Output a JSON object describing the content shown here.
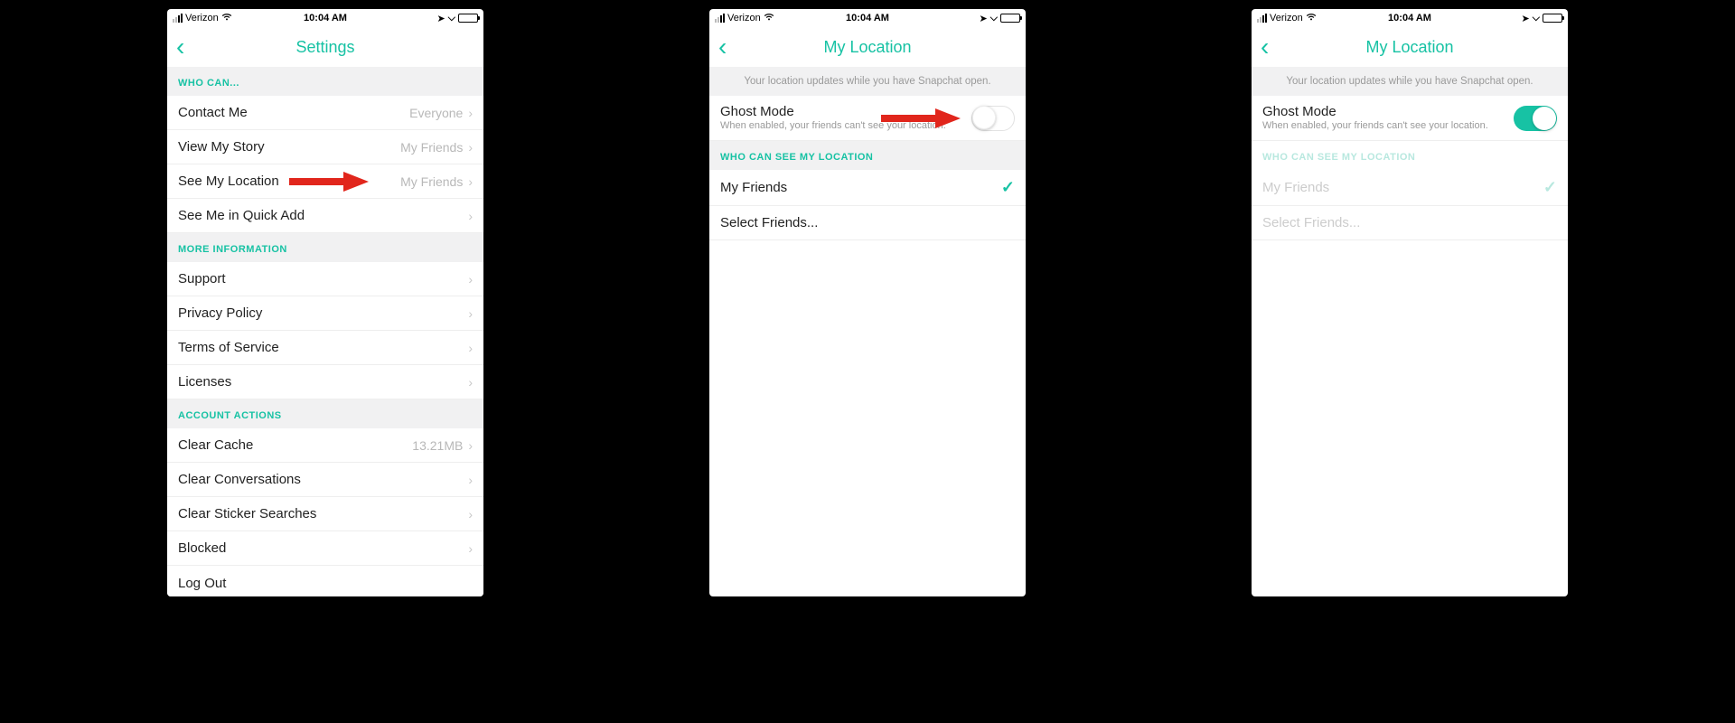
{
  "status": {
    "carrier": "Verizon",
    "time": "10:04 AM"
  },
  "screen1": {
    "title": "Settings",
    "section_who_can": "WHO CAN...",
    "contact_me": "Contact Me",
    "contact_me_value": "Everyone",
    "view_my_story": "View My Story",
    "view_my_story_value": "My Friends",
    "see_my_location": "See My Location",
    "see_my_location_value": "My Friends",
    "see_quick_add": "See Me in Quick Add",
    "section_more_info": "MORE INFORMATION",
    "support": "Support",
    "privacy_policy": "Privacy Policy",
    "terms": "Terms of Service",
    "licenses": "Licenses",
    "section_account": "ACCOUNT ACTIONS",
    "clear_cache": "Clear Cache",
    "clear_cache_value": "13.21MB",
    "clear_conversations": "Clear Conversations",
    "clear_sticker": "Clear Sticker Searches",
    "blocked": "Blocked",
    "log_out": "Log Out"
  },
  "screen2": {
    "title": "My Location",
    "banner": "Your location updates while you have Snapchat open.",
    "ghost_mode": "Ghost Mode",
    "ghost_mode_sub": "When enabled, your friends can't see your location.",
    "section_who_see": "WHO CAN SEE MY LOCATION",
    "my_friends": "My Friends",
    "select_friends": "Select Friends..."
  },
  "screen3": {
    "title": "My Location",
    "banner": "Your location updates while you have Snapchat open.",
    "ghost_mode": "Ghost Mode",
    "ghost_mode_sub": "When enabled, your friends can't see your location.",
    "section_who_see": "WHO CAN SEE MY LOCATION",
    "my_friends": "My Friends",
    "select_friends": "Select Friends..."
  }
}
